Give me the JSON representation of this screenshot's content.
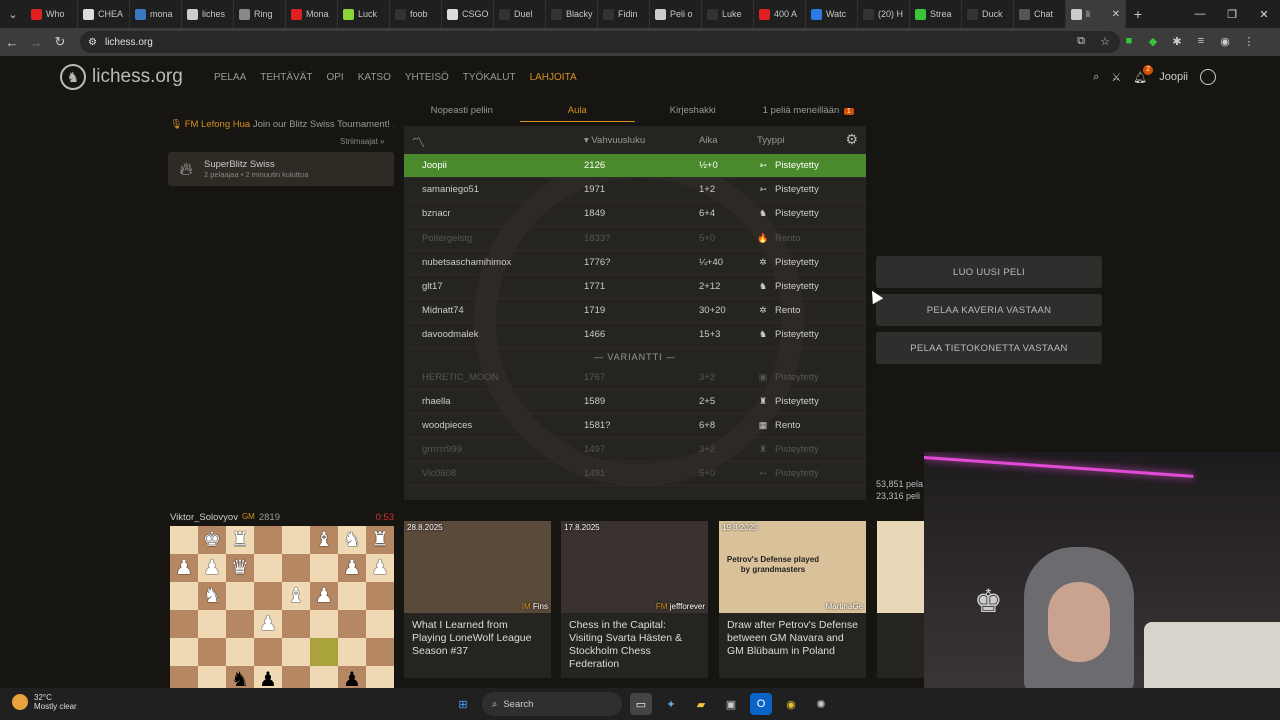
{
  "browser": {
    "tabs": [
      {
        "label": "Who",
        "color": "#e02020"
      },
      {
        "label": "CHEA",
        "color": "#ddd"
      },
      {
        "label": "mona",
        "color": "#3a78c3"
      },
      {
        "label": "liches",
        "color": "#ccc"
      },
      {
        "label": "Ring",
        "color": "#888"
      },
      {
        "label": "Mona",
        "color": "#e02020"
      },
      {
        "label": "Luck",
        "color": "#8bd43a"
      },
      {
        "label": "foob",
        "color": "#333"
      },
      {
        "label": "CSGO",
        "color": "#ddd"
      },
      {
        "label": "Duel",
        "color": "#333"
      },
      {
        "label": "Blacky",
        "color": "#333"
      },
      {
        "label": "Fidin",
        "color": "#333"
      },
      {
        "label": "Peli o",
        "color": "#ccc"
      },
      {
        "label": "Luke",
        "color": "#333"
      },
      {
        "label": "400 A",
        "color": "#e02020"
      },
      {
        "label": "Watc",
        "color": "#2a7be4"
      },
      {
        "label": "(20) H",
        "color": "#333"
      },
      {
        "label": "Strea",
        "color": "#3ac43a"
      },
      {
        "label": "Duck",
        "color": "#333"
      },
      {
        "label": "Chat",
        "color": "#555"
      },
      {
        "label": "li",
        "color": "#ccc"
      }
    ],
    "url": "lichess.org"
  },
  "header": {
    "logo_text": "lichess.org",
    "nav": [
      "PELAA",
      "TEHTÄVÄT",
      "OPI",
      "KATSO",
      "YHTEISÖ",
      "TYÖKALUT",
      "LAHJOITA"
    ],
    "notification_count": "2",
    "username": "Joopii"
  },
  "lobby_tabs": {
    "quick": "Nopeasti peliin",
    "lobby": "Aula",
    "correspondence": "Kirjeshakki",
    "ongoing": "1 peliä meneillään",
    "ongoing_count": "1"
  },
  "stream": {
    "title_name": "FM Lefong Hua",
    "text": "Join our Blitz Swiss Tournament! ...",
    "streamers_link": "Striimaajat »"
  },
  "tournament": {
    "name": "SuperBlitz Swiss",
    "info": "2 pelaajaa • 2 minuutin kuluttua"
  },
  "lobby": {
    "col_rating": "Vahvuusluku",
    "col_time": "Aika",
    "col_type": "Tyyppi",
    "variant_label": "— VARIANTTI —",
    "rows": [
      {
        "name": "Joopii",
        "rating": "2126",
        "time": "½+0",
        "type": "Pisteytetty",
        "icon": "➳"
      },
      {
        "name": "samaniego51",
        "rating": "1971",
        "time": "1+2",
        "type": "Pisteytetty",
        "icon": "➳"
      },
      {
        "name": "bznacr",
        "rating": "1849",
        "time": "6+4",
        "type": "Pisteytetty",
        "icon": "♞"
      },
      {
        "name": "Poltergeistg",
        "rating": "1833?",
        "time": "5+0",
        "type": "Rento",
        "icon": "🔥"
      },
      {
        "name": "nubetsaschamihimox",
        "rating": "1776?",
        "time": "¼+40",
        "type": "Pisteytetty",
        "icon": "✲"
      },
      {
        "name": "glt17",
        "rating": "1771",
        "time": "2+12",
        "type": "Pisteytetty",
        "icon": "♞"
      },
      {
        "name": "Midnatt74",
        "rating": "1719",
        "time": "30+20",
        "type": "Rento",
        "icon": "✲"
      },
      {
        "name": "davoodmalek",
        "rating": "1466",
        "time": "15+3",
        "type": "Pisteytetty",
        "icon": "♞"
      }
    ],
    "variant_rows": [
      {
        "name": "HERETIC_MOON",
        "rating": "1767",
        "time": "3+2",
        "type": "Pisteytetty",
        "icon": "▣"
      },
      {
        "name": "rhaella",
        "rating": "1589",
        "time": "2+5",
        "type": "Pisteytetty",
        "icon": "♜"
      },
      {
        "name": "woodpieces",
        "rating": "1581?",
        "time": "6+8",
        "type": "Rento",
        "icon": "▦"
      },
      {
        "name": "grrrrrr999",
        "rating": "1497",
        "time": "3+2",
        "type": "Pisteytetty",
        "icon": "♜"
      },
      {
        "name": "Vic0608",
        "rating": "1491",
        "time": "5+0",
        "type": "Pisteytetty",
        "icon": "➳"
      }
    ]
  },
  "actions": {
    "create": "LUO UUSI PELI",
    "friend": "PELAA KAVERIA VASTAAN",
    "computer": "PELAA TIETOKONETTA VASTAAN"
  },
  "stats": {
    "players": "53,851 pela",
    "games": "23,316 peli"
  },
  "tv": {
    "player": "Viktor_Solovyov",
    "title": "GM",
    "rating": "2819",
    "clock": "0:53",
    "board": [
      [
        "",
        "wK",
        "wR",
        "",
        "",
        "wB",
        "wN",
        "wR"
      ],
      [
        "wP",
        "wP",
        "wQ",
        "",
        "",
        "",
        "wP",
        "wP"
      ],
      [
        "",
        "wN",
        "",
        "",
        "wB",
        "wP",
        "",
        ""
      ],
      [
        "",
        "",
        "",
        "wP",
        "",
        "",
        "",
        ""
      ],
      [
        "",
        "",
        "",
        "",
        "",
        "",
        "",
        ""
      ],
      [
        "",
        "",
        "bN",
        "bP",
        "",
        "",
        "bP",
        ""
      ]
    ]
  },
  "blog": [
    {
      "date": "28.8.2025",
      "author_title": "IM",
      "author": "Fins",
      "title": "What I Learned from Playing LoneWolf League Season #37",
      "bg": "#5a4a3a"
    },
    {
      "date": "17.8.2025",
      "author_title": "FM",
      "author": "jeffforever",
      "title": "Chess in the Capital: Visiting Svarta Hästen & Stockholm Chess Federation",
      "bg": "#3a3230"
    },
    {
      "date": "19.8.2025",
      "author_title": "",
      "author": "MartinaGe",
      "title": "Draw after Petrov's Defense between GM Navara and GM Blübaum in Poland",
      "overlay": "Petrov's Defense played by grandmasters",
      "bg": "#d9c29a"
    }
  ],
  "taskbar": {
    "temp": "32°C",
    "weather": "Mostly clear",
    "search": "Search"
  }
}
